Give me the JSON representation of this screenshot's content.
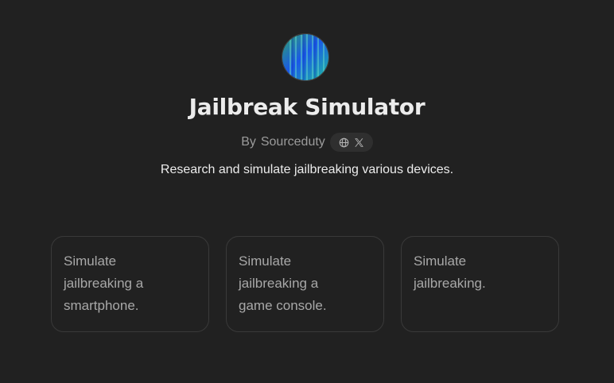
{
  "gpt": {
    "name": "Jailbreak Simulator",
    "by_prefix": "By",
    "author": "Sourceduty",
    "description": "Research and simulate jailbreaking various devices.",
    "social_icons": [
      "globe-icon",
      "x-logo-icon"
    ]
  },
  "starters": [
    {
      "label": "Simulate jailbreaking a smartphone."
    },
    {
      "label": "Simulate jailbreaking a game console."
    },
    {
      "label": "Simulate jailbreaking."
    }
  ],
  "colors": {
    "background": "#212121",
    "title": "#ececec",
    "muted": "#9b9b9b",
    "card_border": "#3a3a3a"
  }
}
